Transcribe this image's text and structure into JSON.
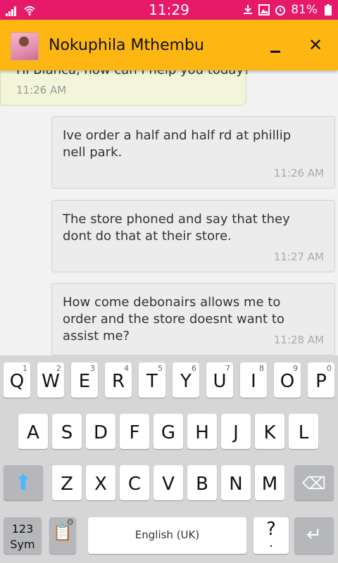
{
  "status_bar": {
    "time": "11:29",
    "battery_percent": "81%",
    "icons": [
      "signal-icon",
      "wifi-icon",
      "download-icon",
      "image-icon",
      "alarm-icon",
      "battery-icon"
    ]
  },
  "header": {
    "contact_name": "Nokuphila Mthembu",
    "minimize_icon": "minimize-icon",
    "close_icon": "close-icon",
    "close_glyph": "✕"
  },
  "messages": [
    {
      "direction": "incoming",
      "text": "Hi Bianca, how can I help you today?",
      "time": "11:26 AM"
    },
    {
      "direction": "outgoing",
      "text": "Ive order a half and half rd at phillip nell park.",
      "time": "11:26 AM"
    },
    {
      "direction": "outgoing",
      "text": "The store phoned and say that they dont do that at their store.",
      "time": "11:27 AM"
    },
    {
      "direction": "outgoing",
      "text": "How come debonairs allows me to order and the store doesnt want to assist me?",
      "time": "11:28 AM"
    }
  ],
  "keyboard": {
    "row1": [
      {
        "label": "Q",
        "num": "1"
      },
      {
        "label": "W",
        "num": "2"
      },
      {
        "label": "E",
        "num": "3"
      },
      {
        "label": "R",
        "num": "4"
      },
      {
        "label": "T",
        "num": "5"
      },
      {
        "label": "Y",
        "num": "6"
      },
      {
        "label": "U",
        "num": "7"
      },
      {
        "label": "I",
        "num": "8"
      },
      {
        "label": "O",
        "num": "9"
      },
      {
        "label": "P",
        "num": "0"
      }
    ],
    "row2": [
      "A",
      "S",
      "D",
      "F",
      "G",
      "H",
      "J",
      "K",
      "L"
    ],
    "row3": [
      "Z",
      "X",
      "C",
      "V",
      "B",
      "N",
      "M"
    ],
    "shift_glyph": "⬆",
    "backspace_glyph": "⌫",
    "sym_label_line1": "123",
    "sym_label_line2": "Sym",
    "clipboard_glyph": "📋",
    "settings_glyph": "⚙",
    "space_label": "English (UK)",
    "dot_top": "?",
    "dot_bottom": ".",
    "enter_glyph": "↵"
  }
}
